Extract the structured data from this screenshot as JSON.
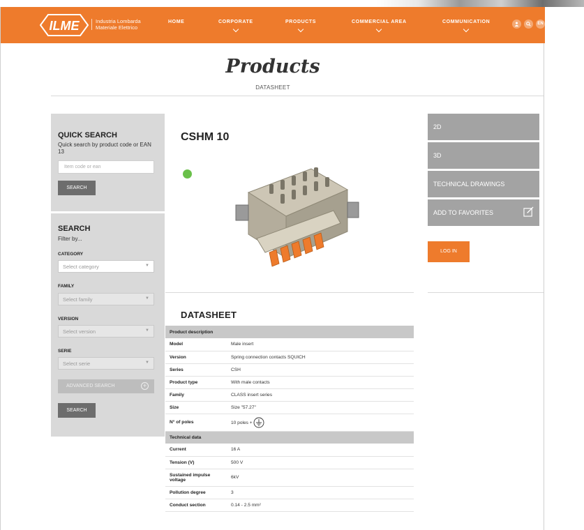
{
  "header": {
    "logo_text": "ILME",
    "company_line1": "Industria Lombarda",
    "company_line2": "Materiale Elettrico",
    "nav": [
      {
        "label": "HOME",
        "has_dropdown": false
      },
      {
        "label": "CORPORATE",
        "has_dropdown": true
      },
      {
        "label": "PRODUCTS",
        "has_dropdown": true
      },
      {
        "label": "COMMERCIAL AREA",
        "has_dropdown": true
      },
      {
        "label": "COMMUNICATION",
        "has_dropdown": true
      }
    ],
    "lang": "EN",
    "accent_color": "#ee7b2c"
  },
  "page": {
    "title": "Products",
    "subtitle": "DATASHEET"
  },
  "quick_search": {
    "title": "QUICK SEARCH",
    "description": "Quick search by product code or EAN 13",
    "placeholder": "Item code or ean",
    "button": "SEARCH"
  },
  "search": {
    "title": "SEARCH",
    "filter_label": "Filter by...",
    "fields": [
      {
        "label": "CATEGORY",
        "placeholder": "Select category"
      },
      {
        "label": "FAMILY",
        "placeholder": "Select family"
      },
      {
        "label": "VERSION",
        "placeholder": "Select version"
      },
      {
        "label": "SERIE",
        "placeholder": "Select serie"
      }
    ],
    "advanced_button": "ADVANCED SEARCH",
    "button": "SEARCH"
  },
  "product": {
    "name": "CSHM 10",
    "status_color": "#6ac04a"
  },
  "side_actions": {
    "items": [
      "2D",
      "3D",
      "TECHNICAL DRAWINGS",
      "ADD TO FAVORITES"
    ],
    "login": "LOG IN"
  },
  "datasheet": {
    "title": "DATASHEET",
    "sections": [
      {
        "title": "Product description",
        "rows": [
          {
            "key": "Model",
            "value": "Male insert"
          },
          {
            "key": "Version",
            "value": "Spring connection contacts SQUICH"
          },
          {
            "key": "Series",
            "value": "CSH"
          },
          {
            "key": "Product type",
            "value": "With male contacts"
          },
          {
            "key": "Family",
            "value": "CLASS insert series"
          },
          {
            "key": "Size",
            "value": "Size \"57.27\""
          },
          {
            "key": "N° of poles",
            "value": "10 poles +"
          }
        ]
      },
      {
        "title": "Technical data",
        "rows": [
          {
            "key": "Current",
            "value": "16 A"
          },
          {
            "key": "Tension (V)",
            "value": "500  V"
          },
          {
            "key": "Sustained impulse voltage",
            "value": "6kV"
          },
          {
            "key": "Pollution degree",
            "value": "3"
          },
          {
            "key": "Conduct section",
            "value": "0.14 - 2.5 mm²"
          }
        ]
      }
    ]
  }
}
